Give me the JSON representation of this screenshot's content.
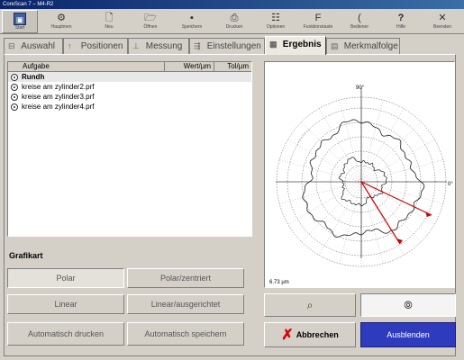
{
  "window": {
    "title": "CoreScan 7 – M4-R2"
  },
  "toolbar": [
    {
      "label": "Start",
      "icon": "start-icon"
    },
    {
      "label": "Hauptmen",
      "icon": "main-menu-icon"
    },
    {
      "label": "Neu",
      "icon": "new-icon"
    },
    {
      "label": "Öffnen",
      "icon": "open-icon"
    },
    {
      "label": "Speichern",
      "icon": "save-icon"
    },
    {
      "label": "Drucken",
      "icon": "print-icon"
    },
    {
      "label": "Optionen",
      "icon": "options-icon"
    },
    {
      "label": "Funktionstaste",
      "icon": "function-key-icon"
    },
    {
      "label": "Bediener",
      "icon": "operator-icon"
    },
    {
      "label": "Hilfe",
      "icon": "help-icon"
    },
    {
      "label": "Beenden",
      "icon": "exit-icon"
    }
  ],
  "tabs": [
    {
      "label": "Auswahl",
      "icon": "select-icon"
    },
    {
      "label": "Positionen",
      "icon": "positions-icon"
    },
    {
      "label": "Messung",
      "icon": "measurement-icon"
    },
    {
      "label": "Einstellungen",
      "icon": "settings-icon"
    },
    {
      "label": "Ergebnis",
      "icon": "result-icon",
      "active": true
    },
    {
      "label": "Merkmalfolge",
      "icon": "feature-sequence-icon"
    }
  ],
  "list": {
    "headers": {
      "task": "Aufgabe",
      "value": "Wert/µm",
      "tolerance": "Tol/µm"
    },
    "rows": [
      {
        "name": "Rundh",
        "selected": true
      },
      {
        "name": "kreise am zylinder2.prf"
      },
      {
        "name": "kreise am zylinder3.prf"
      },
      {
        "name": "kreise am zylinder4.prf"
      }
    ]
  },
  "grafikart": {
    "title": "Grafikart",
    "polar": "Polar",
    "polar_centered": "Polar/zentriert",
    "linear": "Linear",
    "linear_aligned": "Linear/ausgerichtet",
    "auto_print": "Automatisch drucken",
    "auto_save": "Automatisch speichern"
  },
  "chart": {
    "label_90": "90°",
    "label_0": "0°",
    "scale": "6.73 µm"
  },
  "buttons": {
    "cancel": "Abbrechen",
    "hide": "Ausblenden"
  },
  "colors": {
    "accent_blue": "#2e3bbf",
    "cancel_red": "#d00000"
  }
}
